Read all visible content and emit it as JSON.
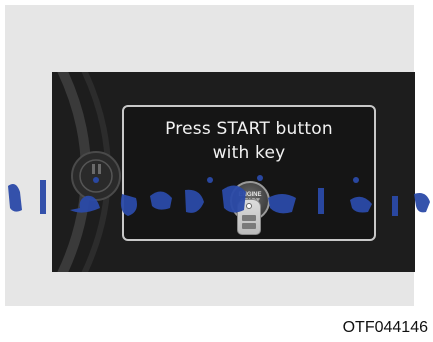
{
  "display": {
    "message_line1": "Press START button",
    "message_line2": "with key",
    "engine_button_line1": "ENGINE",
    "engine_button_line2": "START"
  },
  "caption": "OTF044146",
  "watermark": {
    "text": "مداد خودرو قاره آسیا",
    "color": "#2b4aa8"
  },
  "colors": {
    "panel_bg": "#1d1d1d",
    "frame_bg": "#e6e6e6",
    "message_text": "#f2f2f2"
  }
}
